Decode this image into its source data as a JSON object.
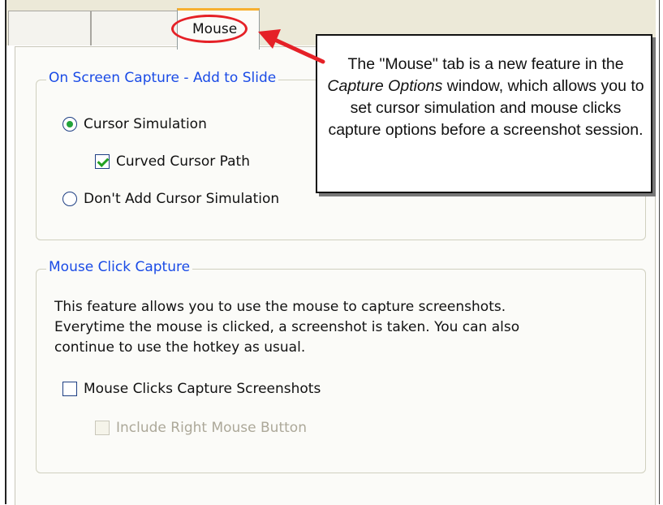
{
  "tabs": {
    "inactive": [
      "",
      ""
    ],
    "active": "Mouse"
  },
  "on_screen_capture": {
    "title": "On Screen Capture - Add to Slide",
    "cursor_simulation": "Cursor Simulation",
    "curved_cursor_path": "Curved Cursor Path",
    "dont_add_cursor": "Don't Add Cursor Simulation"
  },
  "mouse_click_capture": {
    "title": "Mouse Click Capture",
    "description_line1": "This feature allows you to use the mouse to capture screenshots.",
    "description_line2": "Everytime the mouse is clicked, a screenshot is taken. You can also",
    "description_line3": "continue to use the hotkey as usual.",
    "mouse_clicks_capture": "Mouse Clicks Capture Screenshots",
    "include_right_button": "Include Right Mouse Button"
  },
  "callout": {
    "part1": "The \"Mouse\" tab is a new feature in the ",
    "italic": "Capture Options",
    "part2": " window, which allows you to set cursor simulation and mouse clicks capture options before a screenshot session."
  },
  "colors": {
    "legend_blue": "#1a4be6",
    "highlight_red": "#e52127",
    "radio_green": "#23a33a",
    "tab_orange": "#f7b030"
  }
}
